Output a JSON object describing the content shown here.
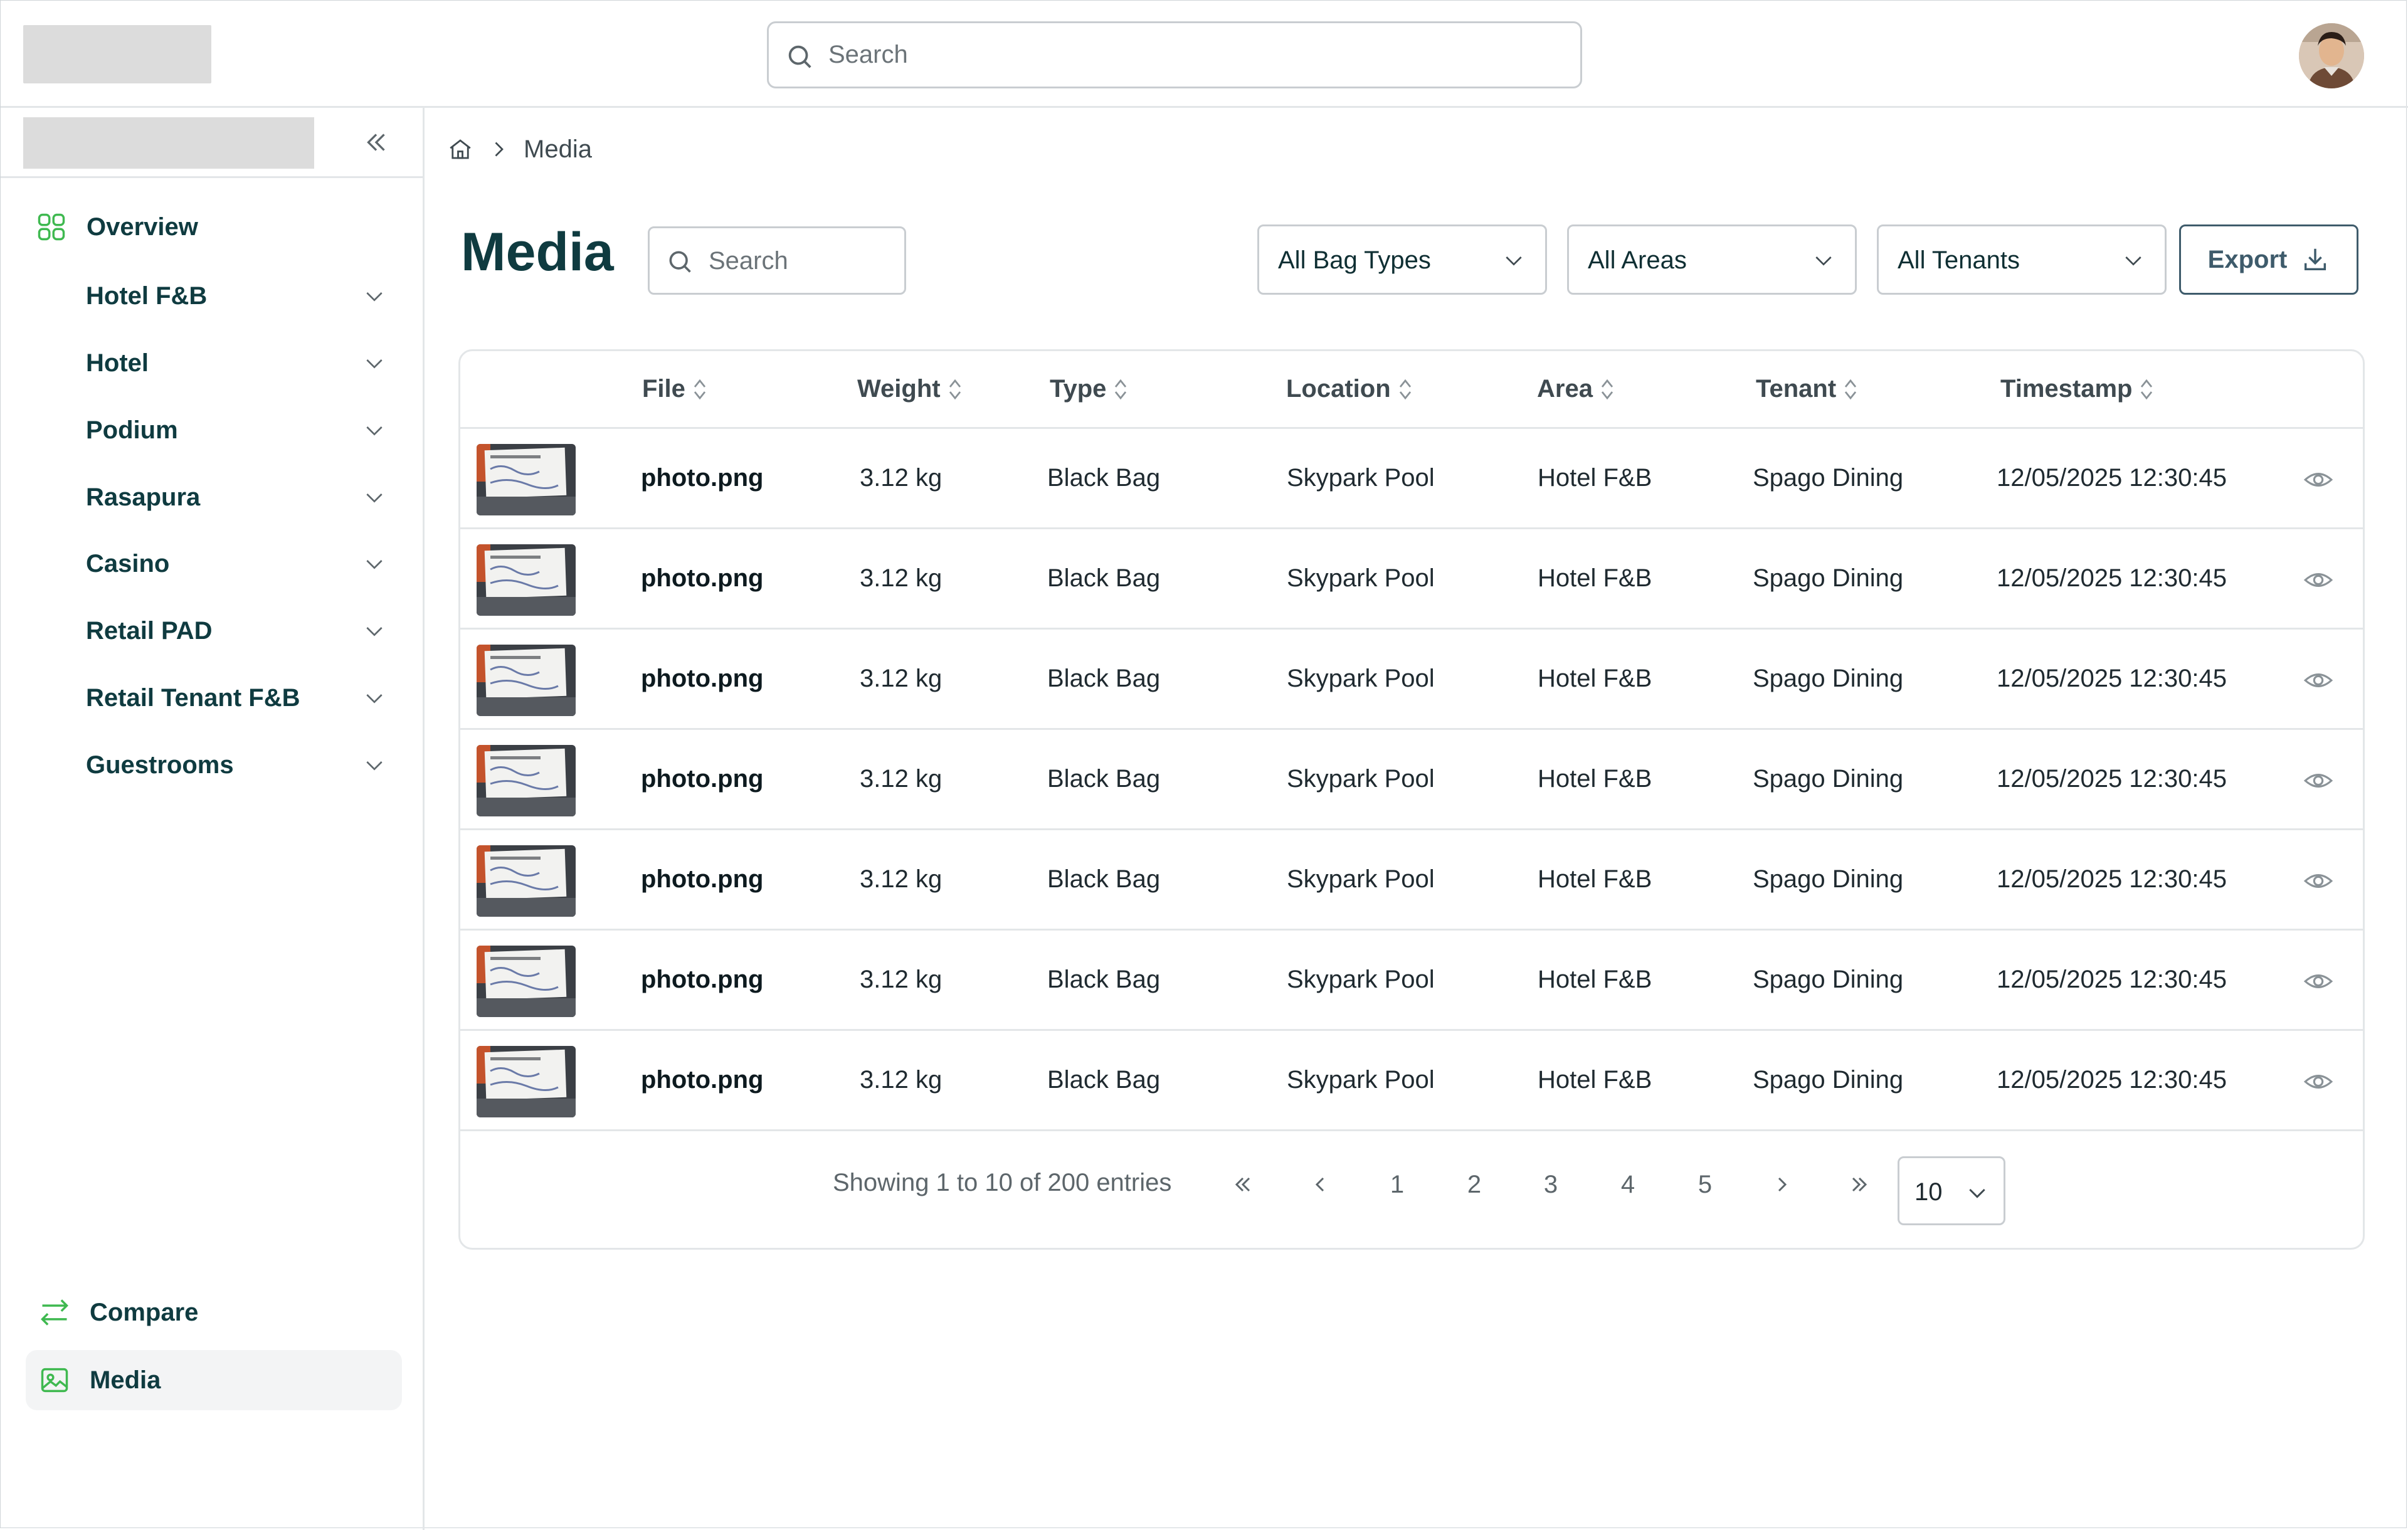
{
  "header": {
    "search_placeholder": "Search",
    "avatar_icon": "user-avatar"
  },
  "sidebar": {
    "collapse_icon": "chevrons-left-icon",
    "overview_label": "Overview",
    "items": [
      {
        "label": "Hotel F&B"
      },
      {
        "label": "Hotel"
      },
      {
        "label": "Podium"
      },
      {
        "label": "Rasapura"
      },
      {
        "label": "Casino"
      },
      {
        "label": "Retail PAD"
      },
      {
        "label": "Retail Tenant F&B"
      },
      {
        "label": "Guestrooms"
      }
    ],
    "compare_label": "Compare",
    "media_label": "Media",
    "accent_color": "#3fb950"
  },
  "breadcrumb": {
    "current": "Media"
  },
  "main": {
    "title": "Media",
    "search_placeholder": "Search",
    "filters": {
      "bag_types": "All Bag Types",
      "areas": "All Areas",
      "tenants": "All Tenants"
    },
    "export_label": "Export"
  },
  "table": {
    "columns": [
      "File",
      "Weight",
      "Type",
      "Location",
      "Area",
      "Tenant",
      "Timestamp"
    ],
    "rows": [
      {
        "file": "photo.png",
        "weight": "3.12 kg",
        "type": "Black Bag",
        "location": "Skypark Pool",
        "area": "Hotel F&B",
        "tenant": "Spago Dining",
        "timestamp": "12/05/2025 12:30:45"
      },
      {
        "file": "photo.png",
        "weight": "3.12 kg",
        "type": "Black Bag",
        "location": "Skypark Pool",
        "area": "Hotel F&B",
        "tenant": "Spago Dining",
        "timestamp": "12/05/2025 12:30:45"
      },
      {
        "file": "photo.png",
        "weight": "3.12 kg",
        "type": "Black Bag",
        "location": "Skypark Pool",
        "area": "Hotel F&B",
        "tenant": "Spago Dining",
        "timestamp": "12/05/2025 12:30:45"
      },
      {
        "file": "photo.png",
        "weight": "3.12 kg",
        "type": "Black Bag",
        "location": "Skypark Pool",
        "area": "Hotel F&B",
        "tenant": "Spago Dining",
        "timestamp": "12/05/2025 12:30:45"
      },
      {
        "file": "photo.png",
        "weight": "3.12 kg",
        "type": "Black Bag",
        "location": "Skypark Pool",
        "area": "Hotel F&B",
        "tenant": "Spago Dining",
        "timestamp": "12/05/2025 12:30:45"
      },
      {
        "file": "photo.png",
        "weight": "3.12 kg",
        "type": "Black Bag",
        "location": "Skypark Pool",
        "area": "Hotel F&B",
        "tenant": "Spago Dining",
        "timestamp": "12/05/2025 12:30:45"
      },
      {
        "file": "photo.png",
        "weight": "3.12 kg",
        "type": "Black Bag",
        "location": "Skypark Pool",
        "area": "Hotel F&B",
        "tenant": "Spago Dining",
        "timestamp": "12/05/2025 12:30:45"
      }
    ]
  },
  "pagination": {
    "showing_text": "Showing 1 to 10 of 200 entries",
    "pages": [
      "1",
      "2",
      "3",
      "4",
      "5"
    ],
    "page_size": "10"
  }
}
